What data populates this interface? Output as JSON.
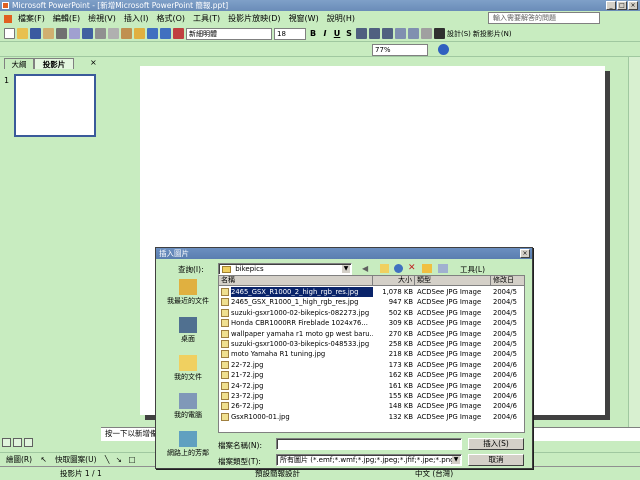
{
  "app": {
    "title": "Microsoft PowerPoint - [新增Microsoft PowerPoint 簡報.ppt]"
  },
  "menu": {
    "items": [
      "檔案(F)",
      "編輯(E)",
      "檢視(V)",
      "插入(I)",
      "格式(O)",
      "工具(T)",
      "投影片放映(D)",
      "視窗(W)",
      "說明(H)"
    ],
    "help_placeholder": "輸入需要解答的問題"
  },
  "toolbar": {
    "font": "新細明體",
    "size": "18",
    "zoom": "77%",
    "bold": "B",
    "italic": "I",
    "underline": "U",
    "shadow": "S",
    "design": "設計(S)",
    "new_slide": "新投影片(N)"
  },
  "left_pane": {
    "tabs": [
      "大綱",
      "投影片"
    ],
    "slide_number": "1"
  },
  "notes": {
    "placeholder": "按一下以新增備"
  },
  "drawbar": {
    "draw": "繪圖(R)",
    "autoshapes": "快取圖案(U)"
  },
  "status": {
    "slide": "投影片 1 / 1",
    "design": "預設簡報設計",
    "language": "中文 (台灣)"
  },
  "dialog": {
    "title": "插入圖片",
    "lookin_label": "查詢(I):",
    "lookin_value": "bikepics",
    "tools_label": "工具(L)",
    "places": [
      "我最近的文件",
      "桌面",
      "我的文件",
      "我的電腦",
      "網路上的芳鄰"
    ],
    "columns": [
      "名稱",
      "大小",
      "類型",
      "修改日"
    ],
    "files": [
      {
        "name": "2465_GSX_R1000_2_high_rgb_res.jpg",
        "size": "1,078 KB",
        "type": "ACDSee JPG Image",
        "date": "2004/5"
      },
      {
        "name": "2465_GSX_R1000_1_high_rgb_res.jpg",
        "size": "947 KB",
        "type": "ACDSee JPG Image",
        "date": "2004/5"
      },
      {
        "name": "suzuki-gsxr1000-02-bikepics-082273.jpg",
        "size": "502 KB",
        "type": "ACDSee JPG Image",
        "date": "2004/5"
      },
      {
        "name": "Honda CBR1000RR Fireblade 1024x76...",
        "size": "309 KB",
        "type": "ACDSee JPG Image",
        "date": "2004/5"
      },
      {
        "name": "wallpaper yamaha r1 moto gp west baru...",
        "size": "270 KB",
        "type": "ACDSee JPG Image",
        "date": "2004/5"
      },
      {
        "name": "suzuki-gsxr1000-03-bikepics-048533.jpg",
        "size": "258 KB",
        "type": "ACDSee JPG Image",
        "date": "2004/5"
      },
      {
        "name": "moto Yamaha R1 tuning.jpg",
        "size": "218 KB",
        "type": "ACDSee JPG Image",
        "date": "2004/5"
      },
      {
        "name": "22-72.jpg",
        "size": "173 KB",
        "type": "ACDSee JPG Image",
        "date": "2004/6"
      },
      {
        "name": "21-72.jpg",
        "size": "162 KB",
        "type": "ACDSee JPG Image",
        "date": "2004/6"
      },
      {
        "name": "24-72.jpg",
        "size": "161 KB",
        "type": "ACDSee JPG Image",
        "date": "2004/6"
      },
      {
        "name": "23-72.jpg",
        "size": "155 KB",
        "type": "ACDSee JPG Image",
        "date": "2004/6"
      },
      {
        "name": "26-72.jpg",
        "size": "148 KB",
        "type": "ACDSee JPG Image",
        "date": "2004/6"
      },
      {
        "name": "GsxR1000-01.jpg",
        "size": "132 KB",
        "type": "ACDSee JPG Image",
        "date": "2004/6"
      }
    ],
    "filename_label": "檔案名稱(N):",
    "filename_value": "",
    "filetype_label": "檔案類型(T):",
    "filetype_value": "所有圖片 (*.emf;*.wmf;*.jpg;*.jpeg;*.jfif;*.jpe;*.png;*.bm",
    "insert_button": "插入(S)",
    "cancel_button": "取消"
  },
  "colors": {
    "background": "#c8ecc0",
    "selection": "#0a246a"
  }
}
